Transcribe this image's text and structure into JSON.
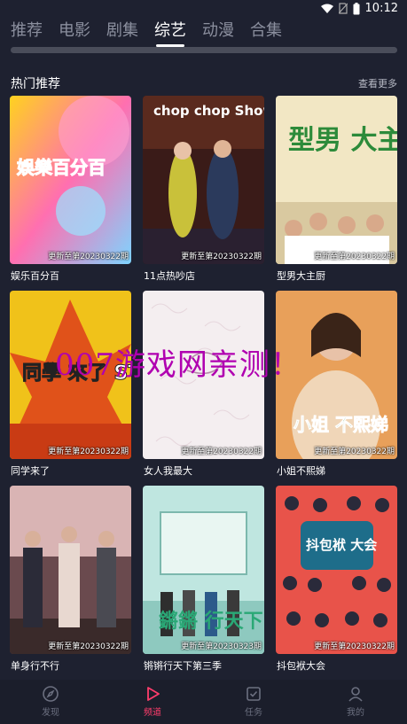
{
  "status_bar": {
    "time": "10:12"
  },
  "tabs": [
    {
      "label": "推荐",
      "active": false
    },
    {
      "label": "电影",
      "active": false
    },
    {
      "label": "剧集",
      "active": false
    },
    {
      "label": "综艺",
      "active": true
    },
    {
      "label": "动漫",
      "active": false
    },
    {
      "label": "合集",
      "active": false
    }
  ],
  "section": {
    "title": "热门推荐",
    "more": "查看更多"
  },
  "shows": [
    {
      "title": "娱乐百分百",
      "update": "更新至第20230322期",
      "poster_text": "娛樂百分百"
    },
    {
      "title": "11点热吵店",
      "update": "更新至第20230322期",
      "poster_text": "chop chop Show"
    },
    {
      "title": "型男大主厨",
      "update": "更新至第20230322期",
      "poster_text": "型男 大主廚"
    },
    {
      "title": "同学来了",
      "update": "更新至第20230322期",
      "poster_text": "同學 來了 STUDENT"
    },
    {
      "title": "女人我最大",
      "update": "更新至第20230322期",
      "poster_text": ""
    },
    {
      "title": "小姐不熙娣",
      "update": "更新至第20230322期",
      "poster_text": "小姐 不熙娣"
    },
    {
      "title": "单身行不行",
      "update": "更新至第20230322期",
      "poster_text": ""
    },
    {
      "title": "锵锵行天下第三季",
      "update": "更新至第20230323期",
      "poster_text": "鏘鏘 行天下"
    },
    {
      "title": "抖包袱大会",
      "update": "更新至第20230322期",
      "poster_text": "抖包袱 大会"
    }
  ],
  "watermark": "007游戏网亲测！",
  "bottom_nav": [
    {
      "label": "发现",
      "icon": "compass-icon",
      "active": false
    },
    {
      "label": "频道",
      "icon": "play-icon",
      "active": true
    },
    {
      "label": "任务",
      "icon": "task-icon",
      "active": false
    },
    {
      "label": "我的",
      "icon": "user-icon",
      "active": false
    }
  ],
  "colors": {
    "background": "#1e2130",
    "accent": "#ff3d6c",
    "inactive": "#6c7080"
  }
}
